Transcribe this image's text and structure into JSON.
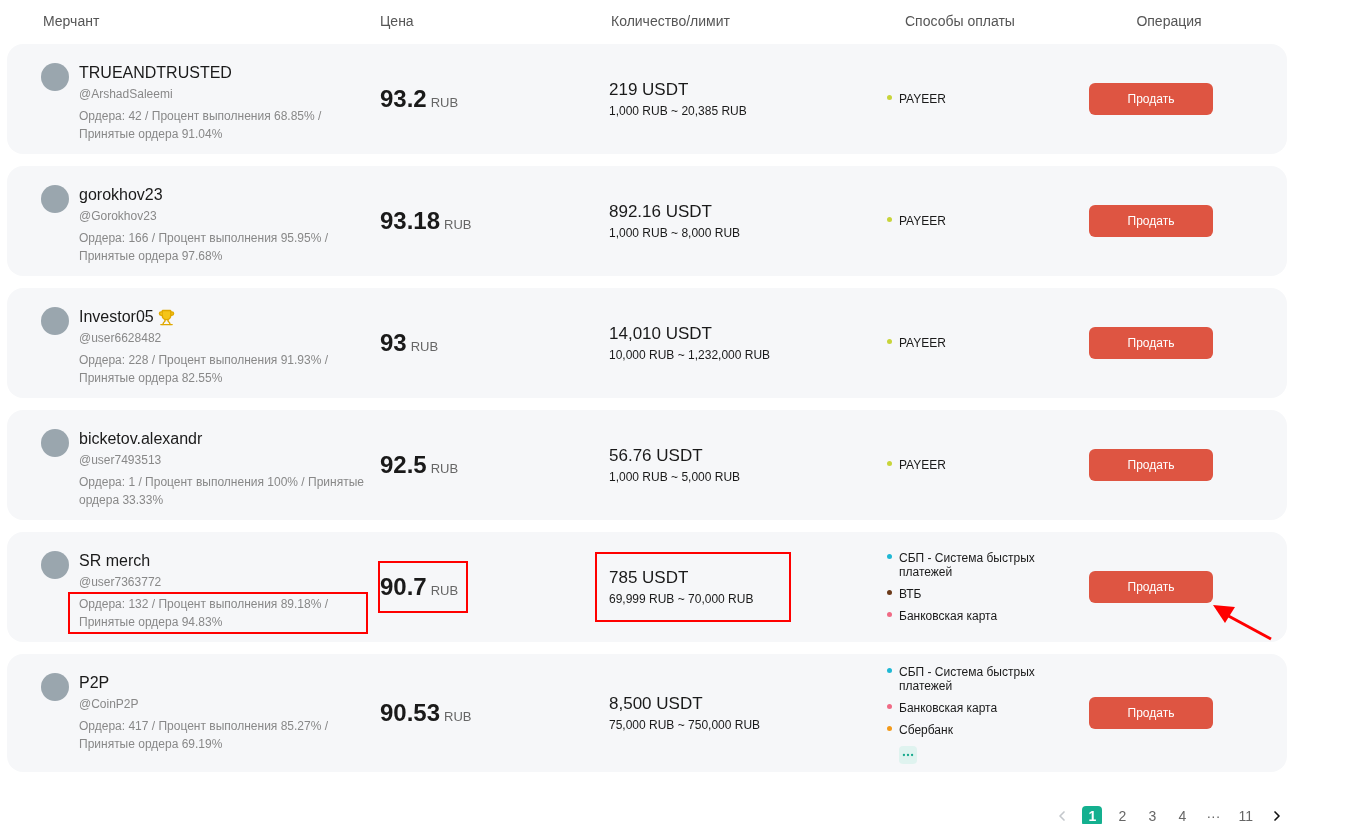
{
  "columns": [
    "Мерчант",
    "Цена",
    "Количество/лимит",
    "Способы оплаты",
    "Операция"
  ],
  "rows": [
    {
      "name": "TRUEANDTRUSTED",
      "trophy": false,
      "handle": "@ArshadSaleemi",
      "stats": "Ордера: 42 / Процент выполнения 68.85% / Принятые ордера 91.04%",
      "price": "93.2",
      "currency": "RUB",
      "amount": "219 USDT",
      "limit": "1,000 RUB ~ 20,385 RUB",
      "methods": [
        {
          "label": "PAYEER",
          "color": "#c8d43a"
        }
      ],
      "more": false,
      "action": "Продать",
      "highlighted": false
    },
    {
      "name": "gorokhov23",
      "trophy": false,
      "handle": "@Gorokhov23",
      "stats": "Ордера: 166 / Процент выполнения 95.95% / Принятые ордера 97.68%",
      "price": "93.18",
      "currency": "RUB",
      "amount": "892.16 USDT",
      "limit": "1,000 RUB ~ 8,000 RUB",
      "methods": [
        {
          "label": "PAYEER",
          "color": "#c8d43a"
        }
      ],
      "more": false,
      "action": "Продать",
      "highlighted": false
    },
    {
      "name": "Investor05",
      "trophy": true,
      "handle": "@user6628482",
      "stats": "Ордера: 228 / Процент выполнения 91.93% / Принятые ордера 82.55%",
      "price": "93",
      "currency": "RUB",
      "amount": "14,010 USDT",
      "limit": "10,000 RUB ~ 1,232,000 RUB",
      "methods": [
        {
          "label": "PAYEER",
          "color": "#c8d43a"
        }
      ],
      "more": false,
      "action": "Продать",
      "highlighted": false
    },
    {
      "name": "bicketov.alexandr",
      "trophy": false,
      "handle": "@user7493513",
      "stats": "Ордера: 1 / Процент выполнения 100% / Принятые ордера 33.33%",
      "price": "92.5",
      "currency": "RUB",
      "amount": "56.76 USDT",
      "limit": "1,000 RUB ~ 5,000 RUB",
      "methods": [
        {
          "label": "PAYEER",
          "color": "#c8d43a"
        }
      ],
      "more": false,
      "action": "Продать",
      "highlighted": false
    },
    {
      "name": "SR merch",
      "trophy": false,
      "handle": "@user7363772",
      "stats": "Ордера: 132 / Процент выполнения 89.18% / Принятые ордера 94.83%",
      "price": "90.7",
      "currency": "RUB",
      "amount": "785 USDT",
      "limit": "69,999 RUB ~ 70,000 RUB",
      "methods": [
        {
          "label": "СБП - Система быстрых платежей",
          "color": "#1fb8d4"
        },
        {
          "label": "ВТБ",
          "color": "#6b3a1a"
        },
        {
          "label": "Банковская карта",
          "color": "#f06a85"
        }
      ],
      "more": false,
      "action": "Продать",
      "highlighted": true
    },
    {
      "name": "P2P",
      "trophy": false,
      "handle": "@CoinP2P",
      "stats": "Ордера: 417 / Процент выполнения 85.27% / Принятые ордера 69.19%",
      "price": "90.53",
      "currency": "RUB",
      "amount": "8,500 USDT",
      "limit": "75,000 RUB ~ 750,000 RUB",
      "methods": [
        {
          "label": "СБП - Система быстрых платежей",
          "color": "#1fb8d4"
        },
        {
          "label": "Банковская карта",
          "color": "#f06a85"
        },
        {
          "label": "Сбербанк",
          "color": "#f39a1a"
        }
      ],
      "more": true,
      "action": "Продать",
      "highlighted": false
    }
  ],
  "pagination": {
    "prev_disabled": true,
    "next_disabled": false,
    "pages": [
      {
        "label": "1",
        "selected": true
      },
      {
        "label": "2",
        "selected": false
      },
      {
        "label": "3",
        "selected": false
      },
      {
        "label": "4",
        "selected": false
      },
      {
        "label": "···",
        "selected": false
      },
      {
        "label": "11",
        "selected": false
      }
    ]
  }
}
